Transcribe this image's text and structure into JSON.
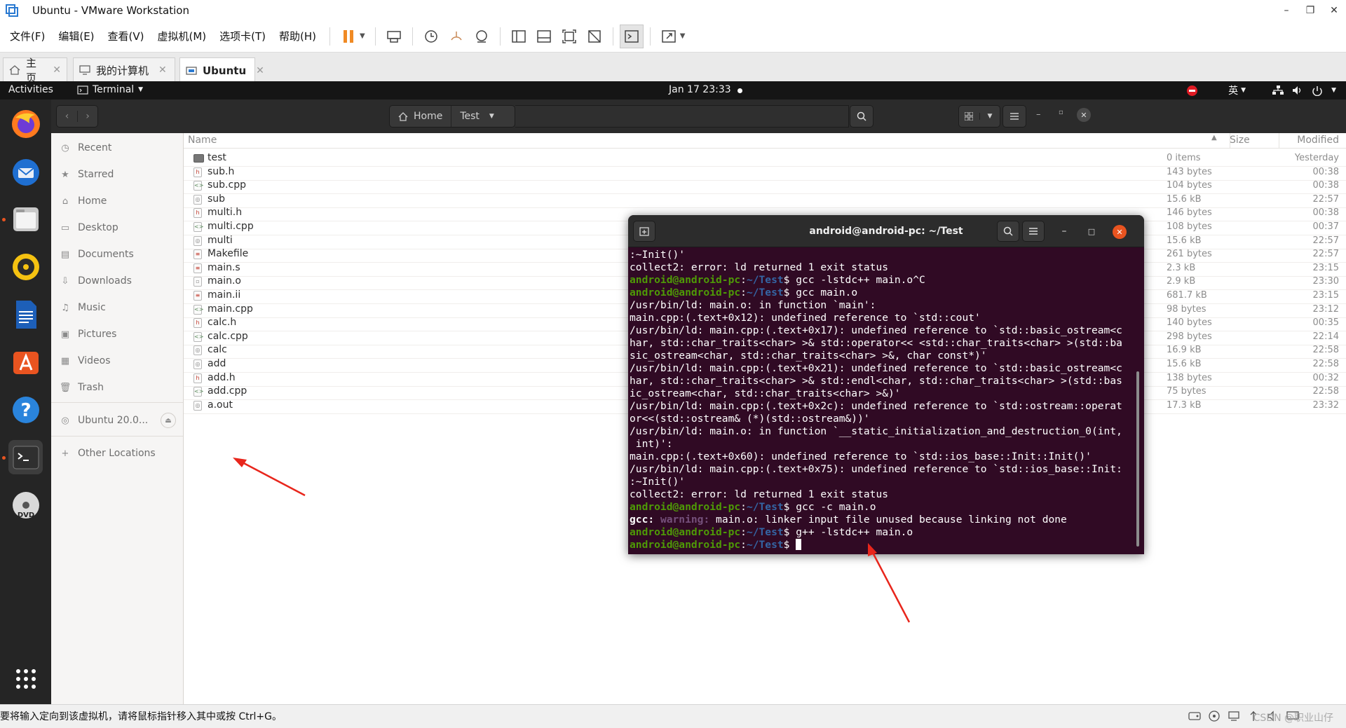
{
  "window": {
    "title": "Ubuntu - VMware Workstation"
  },
  "menubar": {
    "items": [
      "文件(F)",
      "编辑(E)",
      "查看(V)",
      "虚拟机(M)",
      "选项卡(T)",
      "帮助(H)"
    ]
  },
  "tabs": [
    {
      "label": "主页",
      "icon": "home-icon"
    },
    {
      "label": "我的计算机",
      "icon": "computer-icon"
    },
    {
      "label": "Ubuntu",
      "icon": "vm-icon",
      "active": true
    }
  ],
  "gnome": {
    "activities": "Activities",
    "app_menu": "Terminal",
    "clock": "Jan 17  23:33",
    "input_method": "英"
  },
  "nautilus": {
    "path": {
      "home": "Home",
      "folder": "Test"
    },
    "columns": {
      "name": "Name",
      "size": "Size",
      "modified": "Modified"
    },
    "sidebar": [
      {
        "label": "Recent",
        "icon": "clock-icon"
      },
      {
        "label": "Starred",
        "icon": "star-icon"
      },
      {
        "label": "Home",
        "icon": "home-icon"
      },
      {
        "label": "Desktop",
        "icon": "desktop-icon"
      },
      {
        "label": "Documents",
        "icon": "document-icon"
      },
      {
        "label": "Downloads",
        "icon": "download-icon"
      },
      {
        "label": "Music",
        "icon": "music-icon"
      },
      {
        "label": "Pictures",
        "icon": "picture-icon"
      },
      {
        "label": "Videos",
        "icon": "video-icon"
      },
      {
        "label": "Trash",
        "icon": "trash-icon"
      }
    ],
    "device": "Ubuntu 20.0...",
    "other_locations": "Other Locations",
    "files": [
      {
        "name": "test",
        "size": "0 items",
        "modified": "Yesterday",
        "kind": "folder"
      },
      {
        "name": "sub.h",
        "size": "143 bytes",
        "modified": "00:38",
        "kind": "header"
      },
      {
        "name": "sub.cpp",
        "size": "104 bytes",
        "modified": "00:38",
        "kind": "source"
      },
      {
        "name": "sub",
        "size": "15.6 kB",
        "modified": "22:57",
        "kind": "exec"
      },
      {
        "name": "multi.h",
        "size": "146 bytes",
        "modified": "00:38",
        "kind": "header"
      },
      {
        "name": "multi.cpp",
        "size": "108 bytes",
        "modified": "00:37",
        "kind": "source"
      },
      {
        "name": "multi",
        "size": "15.6 kB",
        "modified": "22:57",
        "kind": "exec"
      },
      {
        "name": "Makefile",
        "size": "261 bytes",
        "modified": "22:57",
        "kind": "text"
      },
      {
        "name": "main.s",
        "size": "2.3 kB",
        "modified": "23:15",
        "kind": "text"
      },
      {
        "name": "main.o",
        "size": "2.9 kB",
        "modified": "23:30",
        "kind": "object"
      },
      {
        "name": "main.ii",
        "size": "681.7 kB",
        "modified": "23:15",
        "kind": "text"
      },
      {
        "name": "main.cpp",
        "size": "98 bytes",
        "modified": "23:12",
        "kind": "source"
      },
      {
        "name": "calc.h",
        "size": "140 bytes",
        "modified": "00:35",
        "kind": "header"
      },
      {
        "name": "calc.cpp",
        "size": "298 bytes",
        "modified": "22:14",
        "kind": "source"
      },
      {
        "name": "calc",
        "size": "16.9 kB",
        "modified": "22:58",
        "kind": "exec"
      },
      {
        "name": "add",
        "size": "15.6 kB",
        "modified": "22:58",
        "kind": "exec"
      },
      {
        "name": "add.h",
        "size": "138 bytes",
        "modified": "00:32",
        "kind": "header"
      },
      {
        "name": "add.cpp",
        "size": "75 bytes",
        "modified": "22:58",
        "kind": "source"
      },
      {
        "name": "a.out",
        "size": "17.3 kB",
        "modified": "23:32",
        "kind": "exec"
      }
    ]
  },
  "terminal": {
    "title": "android@android-pc: ~/Test",
    "prompt_user": "android@android-pc",
    "prompt_sep": ":",
    "prompt_path": "~/Test",
    "prompt_end": "$",
    "lines": [
      {
        "t": "out",
        "text": ":~Init()'"
      },
      {
        "t": "out",
        "text": "collect2: error: ld returned 1 exit status"
      },
      {
        "t": "cmd",
        "text": " gcc -lstdc++ main.o^C"
      },
      {
        "t": "cmd",
        "text": " gcc main.o"
      },
      {
        "t": "out",
        "text": "/usr/bin/ld: main.o: in function `main':"
      },
      {
        "t": "out",
        "text": "main.cpp:(.text+0x12): undefined reference to `std::cout'"
      },
      {
        "t": "out",
        "text": "/usr/bin/ld: main.cpp:(.text+0x17): undefined reference to `std::basic_ostream<c"
      },
      {
        "t": "out",
        "text": "har, std::char_traits<char> >& std::operator<< <std::char_traits<char> >(std::ba"
      },
      {
        "t": "out",
        "text": "sic_ostream<char, std::char_traits<char> >&, char const*)'"
      },
      {
        "t": "out",
        "text": "/usr/bin/ld: main.cpp:(.text+0x21): undefined reference to `std::basic_ostream<c"
      },
      {
        "t": "out",
        "text": "har, std::char_traits<char> >& std::endl<char, std::char_traits<char> >(std::bas"
      },
      {
        "t": "out",
        "text": "ic_ostream<char, std::char_traits<char> >&)'"
      },
      {
        "t": "out",
        "text": "/usr/bin/ld: main.cpp:(.text+0x2c): undefined reference to `std::ostream::operat"
      },
      {
        "t": "out",
        "text": "or<<(std::ostream& (*)(std::ostream&))'"
      },
      {
        "t": "out",
        "text": "/usr/bin/ld: main.o: in function `__static_initialization_and_destruction_0(int,"
      },
      {
        "t": "out",
        "text": " int)':"
      },
      {
        "t": "out",
        "text": "main.cpp:(.text+0x60): undefined reference to `std::ios_base::Init::Init()'"
      },
      {
        "t": "out",
        "text": "/usr/bin/ld: main.cpp:(.text+0x75): undefined reference to `std::ios_base::Init:"
      },
      {
        "t": "out",
        "text": ":~Init()'"
      },
      {
        "t": "out",
        "text": "collect2: error: ld returned 1 exit status"
      },
      {
        "t": "cmd",
        "text": " gcc -c main.o"
      },
      {
        "t": "warn",
        "label": "gcc:",
        "level": "warning:",
        "text": " main.o: linker input file unused because linking not done"
      },
      {
        "t": "cmd",
        "text": " g++ -lstdc++ main.o"
      },
      {
        "t": "cmd",
        "text": " ",
        "cursor": true
      }
    ]
  },
  "status": {
    "message": "要将输入定向到该虚拟机，请将鼠标指针移入其中或按 Ctrl+G。",
    "watermark": "CSDN @职业山仔"
  },
  "colors": {
    "ubuntu_orange": "#e95420",
    "terminal_bg": "#300a24",
    "prompt_user": "#4e9a06",
    "prompt_path": "#3465a4",
    "annotation_arrow": "#e8261c",
    "pause_orange": "#f08a24"
  }
}
